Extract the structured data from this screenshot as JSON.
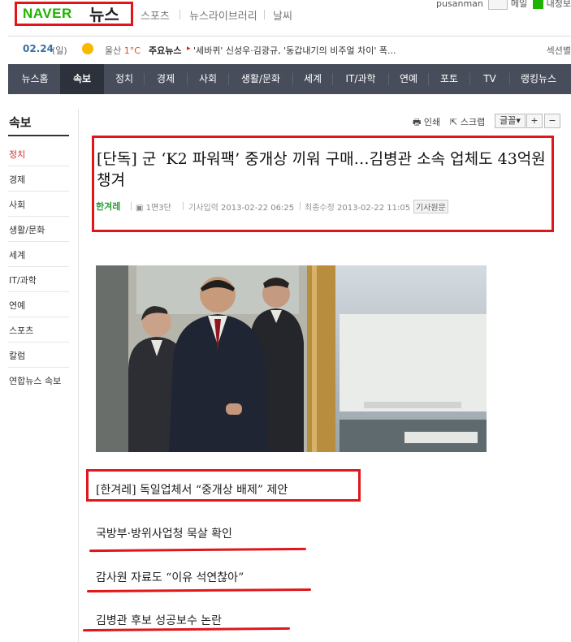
{
  "header": {
    "brand_naver": "NAVER",
    "brand_news": "뉴스",
    "nav": [
      "스포츠",
      "뉴스라이브러리",
      "날씨"
    ],
    "top_right": {
      "user": "pusanman",
      "mail": "메일",
      "more": "내정보"
    }
  },
  "info_bar": {
    "date": "02.24",
    "day": "(일)",
    "weather_city": "울산",
    "weather_temp": "1°C",
    "key_news_label": "주요뉴스",
    "key_news_text": "'세바퀴' 신성우·김광규, '동갑내기의 비주얼 차이' 폭...",
    "right_text": "섹션별"
  },
  "main_nav": [
    "뉴스홈",
    "속보",
    "정치",
    "경제",
    "사회",
    "생활/문화",
    "세계",
    "IT/과학",
    "연예",
    "포토",
    "TV",
    "랭킹뉴스"
  ],
  "sidebar": {
    "title": "속보",
    "items": [
      "정치",
      "경제",
      "사회",
      "생활/문화",
      "세계",
      "IT/과학",
      "연예",
      "스포츠",
      "칼럼",
      "연합뉴스 속보"
    ]
  },
  "tools": {
    "print": "인쇄",
    "scrap": "스크랩",
    "font": "글꼴",
    "plus": "+",
    "minus": "−"
  },
  "article": {
    "headline": "[단독] 군 ‘K2 파워팩’ 중개상 끼워 구매…김병관 소속 업체도 43억원 챙겨",
    "publisher": "한겨레",
    "page": "1면3단",
    "input_label": "기사입력",
    "input_time": "2013-02-22 06:25",
    "modified_label": "최종수정",
    "modified_time": "2013-02-22 11:05",
    "original_label": "기사원문",
    "subheads": [
      "[한겨레] 독일업체서 “중개상 배제” 제안",
      "국방부·방위사업청 묵살 확인",
      "감사원 자료도 “이유 석연찮아”",
      "김병관 후보 성공보수 논란"
    ]
  },
  "colors": {
    "brand_green": "#1fb200",
    "highlight_red": "#e0161b",
    "nav_bg": "#474d5a",
    "active_red": "#d0312d"
  }
}
